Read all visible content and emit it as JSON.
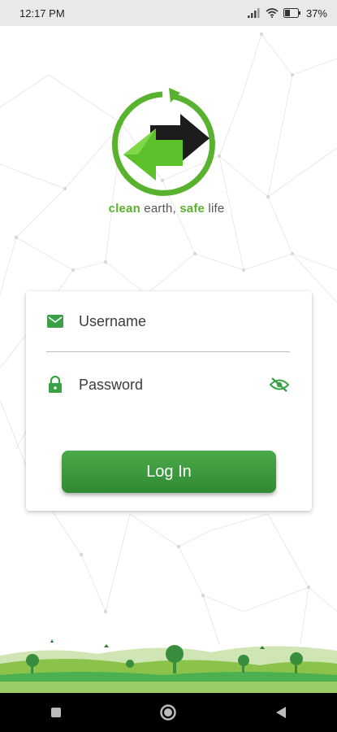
{
  "status_bar": {
    "time": "12:17 PM",
    "battery": "37%",
    "icons": [
      "signal-icon",
      "wifi-icon",
      "battery-icon"
    ]
  },
  "logo": {
    "tagline_part1": "clean",
    "tagline_part2": " earth, ",
    "tagline_part3": "safe",
    "tagline_part4": " life"
  },
  "login_form": {
    "username_placeholder": "Username",
    "password_placeholder": "Password",
    "login_label": "Log In",
    "icons": [
      "mail-icon",
      "lock-icon",
      "eye-toggle-icon"
    ]
  },
  "nav_bar": {
    "icons": [
      "recents-icon",
      "home-icon",
      "back-icon"
    ]
  },
  "colors": {
    "accent": "#4caa4a",
    "accent_dark": "#2f8a33",
    "icon_green": "#3aa046",
    "logo_green": "#59b22d"
  }
}
